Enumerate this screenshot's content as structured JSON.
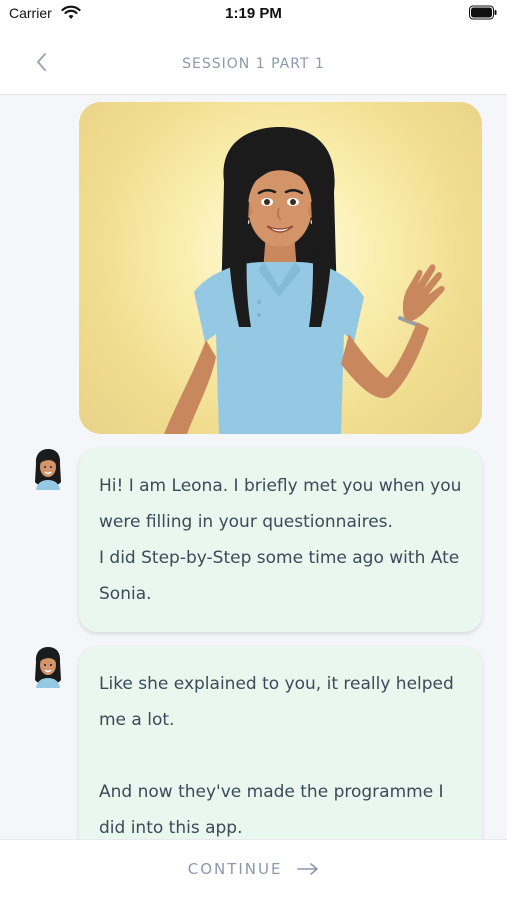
{
  "status_bar": {
    "carrier": "Carrier",
    "time": "1:19 PM"
  },
  "nav": {
    "title": "SESSION 1 PART 1"
  },
  "messages": [
    {
      "lines": [
        "Hi! I am Leona. I briefly met you when you were filling in your questionnaires.",
        "I did Step-by-Step some time ago with Ate Sonia."
      ]
    },
    {
      "lines": [
        "Like she explained to you, it really helped me a lot.",
        "And now they've made the programme I did into this app."
      ]
    }
  ],
  "footer": {
    "continue_label": "CONTINUE"
  },
  "colors": {
    "accent": "#8a99ab",
    "bubble": "#eaf7ee",
    "hero_bg": "#f0dc8e",
    "shirt": "#95c9e3"
  },
  "icons": [
    "wifi-icon",
    "battery-icon",
    "back-chevron-icon",
    "arrow-right-icon"
  ]
}
